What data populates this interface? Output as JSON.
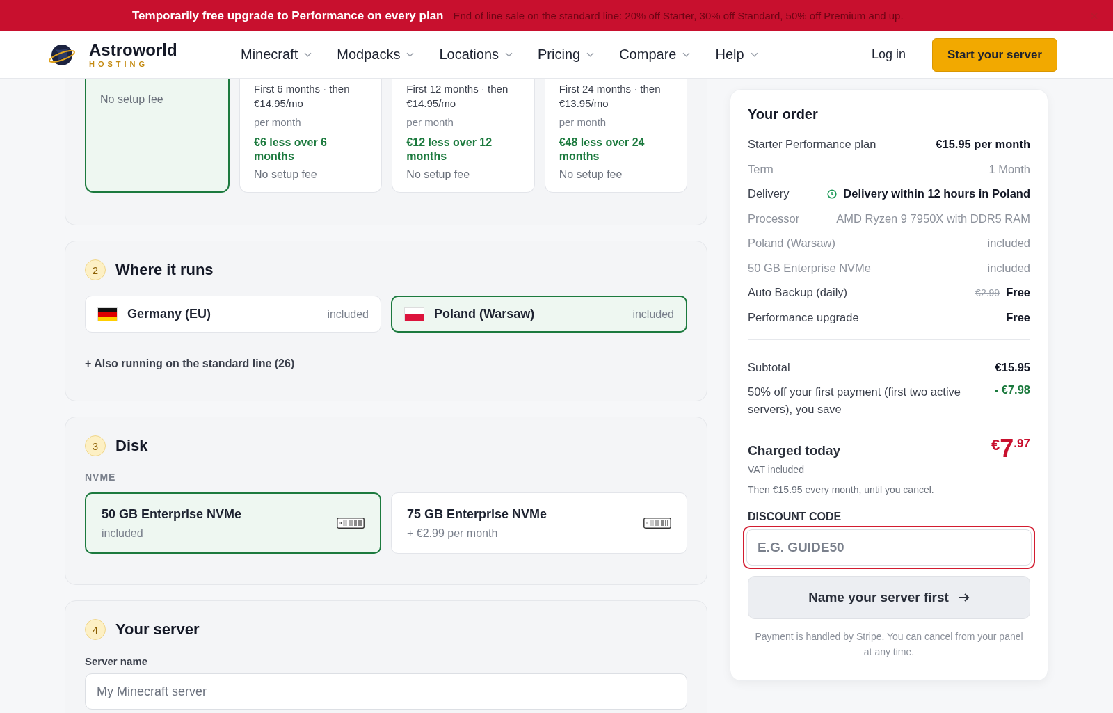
{
  "banner": {
    "headline": "Temporarily free upgrade to Performance on every plan",
    "detail": "End of line sale on the standard line: 20% off Starter, 30% off Standard, 50% off Premium and up."
  },
  "brand": {
    "name": "Astroworld",
    "tagline": "HOSTING"
  },
  "nav": [
    {
      "label": "Minecraft"
    },
    {
      "label": "Modpacks"
    },
    {
      "label": "Locations"
    },
    {
      "label": "Pricing"
    },
    {
      "label": "Compare"
    },
    {
      "label": "Help"
    }
  ],
  "login": "Log in",
  "cta": "Start your server",
  "terms": [
    {
      "selected": true,
      "setup": "No setup fee"
    },
    {
      "selected": false,
      "note": "First 6 months · then",
      "price": "€14.95/mo",
      "period": "per month",
      "saving": "€6 less over 6 months",
      "setup": "No setup fee"
    },
    {
      "selected": false,
      "note": "First 12 months · then",
      "price": "€14.95/mo",
      "period": "per month",
      "saving": "€12 less over 12 months",
      "setup": "No setup fee"
    },
    {
      "selected": false,
      "note": "First 24 months · then",
      "price": "€13.95/mo",
      "period": "per month",
      "saving": "€48 less over 24 months",
      "setup": "No setup fee"
    }
  ],
  "locations": {
    "step": "2",
    "title": "Where it runs",
    "options": [
      {
        "name": "Germany (EU)",
        "kind": "de",
        "price": "included",
        "selected": false
      },
      {
        "name": "Poland (Warsaw)",
        "kind": "pl",
        "price": "included",
        "selected": true
      }
    ],
    "more": "+ Also running on the standard line (26)"
  },
  "disk": {
    "step": "3",
    "title": "Disk",
    "group": "NVME",
    "options": [
      {
        "name": "50 GB Enterprise NVMe",
        "price": "included",
        "selected": true
      },
      {
        "name": "75 GB Enterprise NVMe",
        "price": "+ €2.99 per month",
        "selected": false
      }
    ]
  },
  "server": {
    "step": "4",
    "title": "Your server",
    "label": "Server name",
    "placeholder": "My Minecraft server"
  },
  "order": {
    "title": "Your order",
    "lines": [
      {
        "kind": "normal",
        "label": "Starter Performance plan",
        "value": "€15.95 per month"
      },
      {
        "kind": "muted",
        "label": "Term",
        "value": "1 Month"
      },
      {
        "kind": "delivery",
        "label": "Delivery",
        "value": "Delivery within 12 hours in Poland"
      },
      {
        "kind": "muted",
        "label": "Processor",
        "value": "AMD Ryzen 9 7950X with DDR5 RAM"
      },
      {
        "kind": "muted",
        "label": "Poland (Warsaw)",
        "value": "included"
      },
      {
        "kind": "muted",
        "label": "50 GB Enterprise NVMe",
        "value": "included"
      },
      {
        "kind": "discounted",
        "label": "Auto Backup (daily)",
        "old": "€2.99",
        "value": "Free"
      },
      {
        "kind": "normal",
        "label": "Performance upgrade",
        "value": "Free"
      }
    ],
    "subtotal": {
      "label": "Subtotal",
      "value": "€15.95"
    },
    "discount": {
      "label": "50% off your first payment (first two active servers), you save",
      "value": "- €7.98"
    },
    "charged": {
      "label": "Charged today",
      "currency": "€",
      "whole": "7",
      "cents": ".97"
    },
    "vat": "VAT included",
    "then": "Then €15.95 every month, until you cancel.",
    "code": {
      "label": "DISCOUNT CODE",
      "placeholder": "E.G. GUIDE50",
      "invalid": true
    },
    "submit": {
      "label": "Name your server first",
      "disabled": true
    },
    "note": "Payment is handled by Stripe. You can cancel from your panel at any time."
  }
}
